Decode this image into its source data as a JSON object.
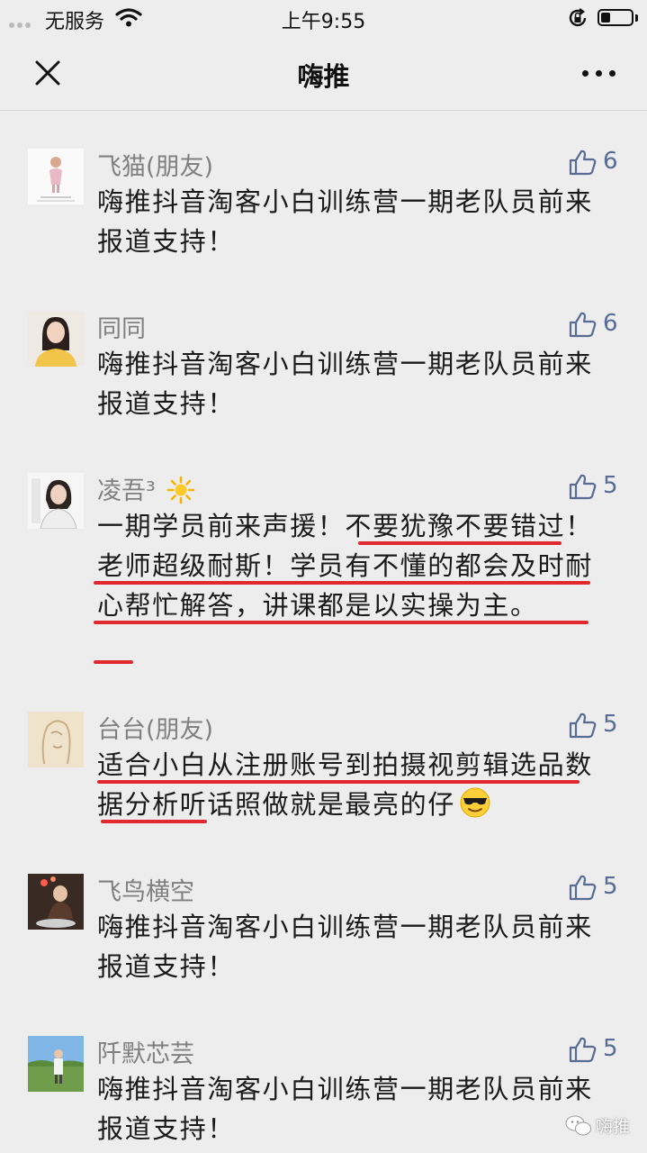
{
  "status_bar": {
    "carrier": "无服务",
    "time": "上午9:55",
    "battery_level": 0.3
  },
  "nav": {
    "title": "嗨推"
  },
  "comments": [
    {
      "nickname": "飞猫(朋友)",
      "likes": "6",
      "text": "嗨推抖音淘客小白训练营一期老队员前来报道支持！"
    },
    {
      "nickname": "同同",
      "likes": "6",
      "text": "嗨推抖音淘客小白训练营一期老队员前来报道支持！"
    },
    {
      "nickname": "凌吾³",
      "likes": "5",
      "text": "一期学员前来声援！不要犹豫不要错过！老师超级耐斯！学员有不懂的都会及时耐心帮忙解答，讲课都是以实操为主。"
    },
    {
      "nickname": "台台(朋友)",
      "likes": "5",
      "text": "适合小白从注册账号到拍摄视剪辑选品数据分析听话照做就是最亮的仔"
    },
    {
      "nickname": "飞鸟横空",
      "likes": "5",
      "text": "嗨推抖音淘客小白训练营一期老队员前来报道支持！"
    },
    {
      "nickname": "阡默芯芸",
      "likes": "5",
      "text": "嗨推抖音淘客小白训练营一期老队员前来报道支持！"
    }
  ],
  "watermark": {
    "text": "嗨推"
  },
  "colors": {
    "background": "#ededed",
    "link_blue": "#576b95",
    "underline_red": "#e0282e",
    "nickname_gray": "#808080"
  },
  "icons": [
    "wifi-icon",
    "rotation-lock-icon",
    "battery-icon",
    "close-icon",
    "more-icon",
    "thumbs-up-icon",
    "sun-emoji",
    "cool-emoji",
    "wechat-icon"
  ]
}
